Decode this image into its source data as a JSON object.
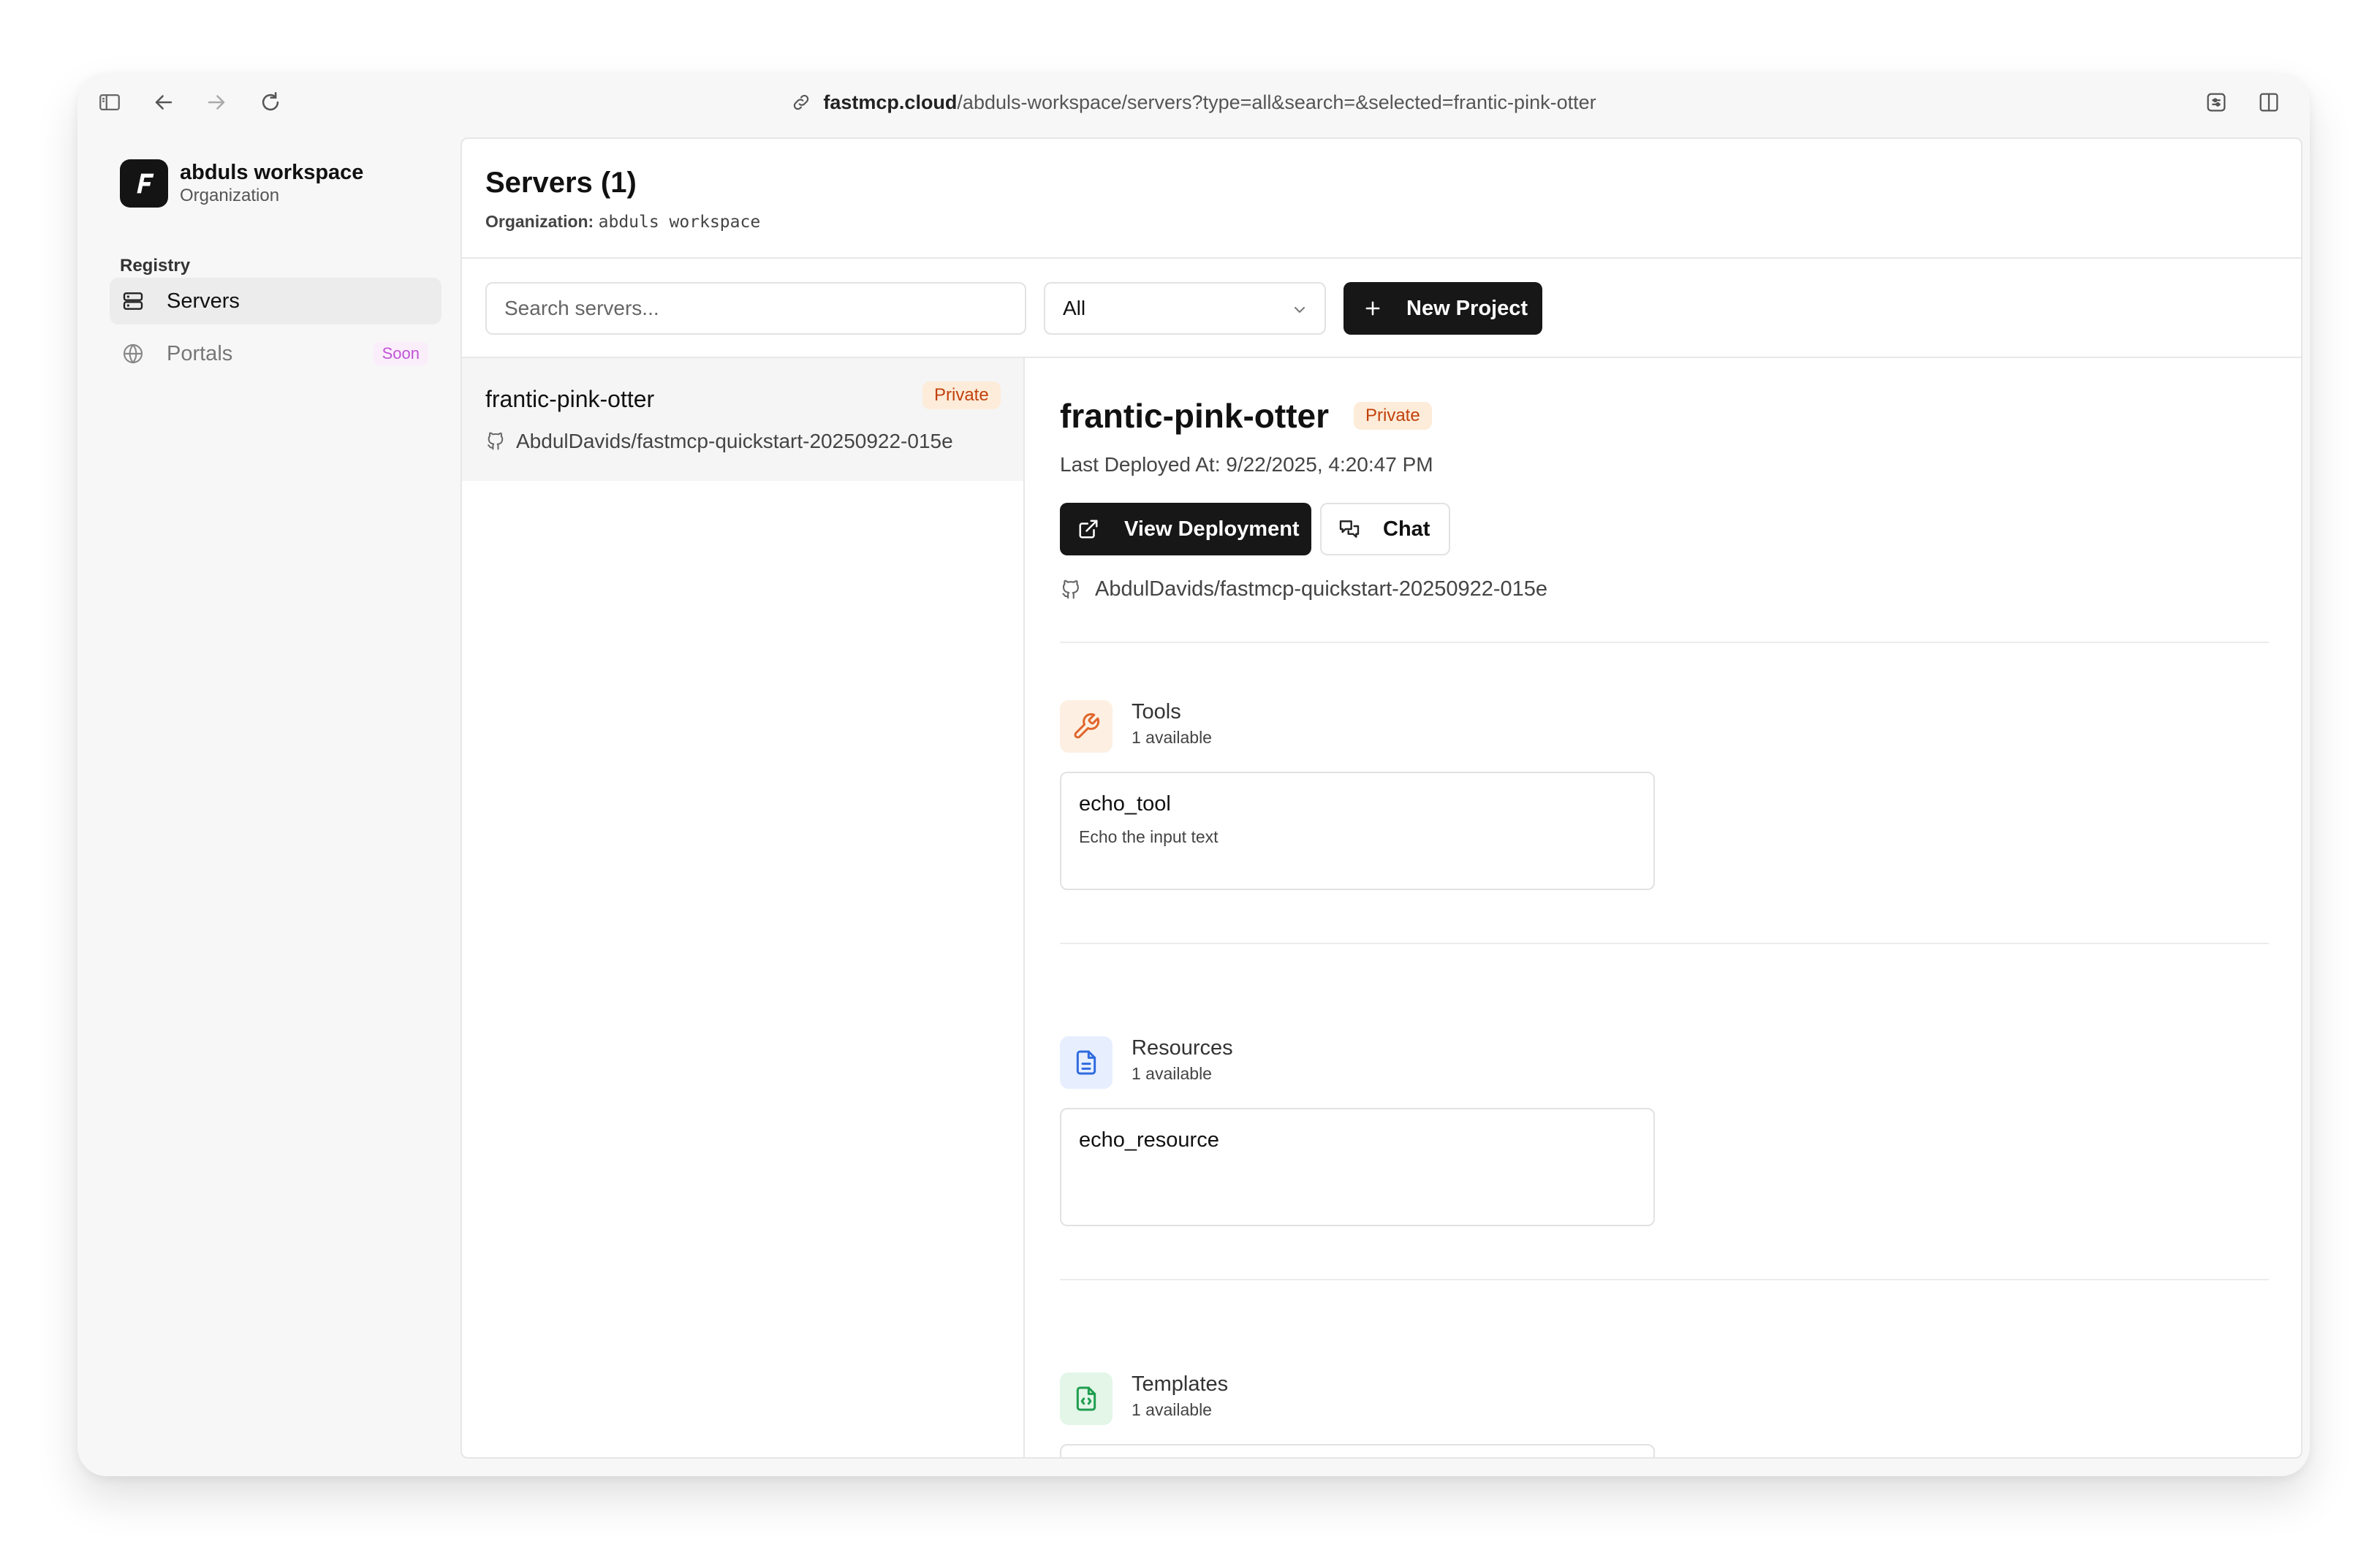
{
  "browser": {
    "url_host": "fastmcp.cloud",
    "url_path": "/abduls-workspace/servers?type=all&search=&selected=frantic-pink-otter"
  },
  "sidebar": {
    "workspace_name": "abduls workspace",
    "workspace_type": "Organization",
    "section_label": "Registry",
    "items": [
      {
        "label": "Servers",
        "icon": "server-icon",
        "active": true
      },
      {
        "label": "Portals",
        "icon": "globe-icon",
        "badge": "Soon"
      }
    ]
  },
  "header": {
    "title": "Servers (1)",
    "org_label": "Organization:",
    "org_value": "abduls workspace"
  },
  "filters": {
    "search_placeholder": "Search servers...",
    "type_selected": "All",
    "new_project_label": "New Project"
  },
  "server_list": [
    {
      "name": "frantic-pink-otter",
      "visibility": "Private",
      "repo": "AbdulDavids/fastmcp-quickstart-20250922-015e"
    }
  ],
  "detail": {
    "name": "frantic-pink-otter",
    "visibility": "Private",
    "last_deployed": "Last Deployed At: 9/22/2025, 4:20:47 PM",
    "view_deployment_label": "View Deployment",
    "chat_label": "Chat",
    "repo": "AbdulDavids/fastmcp-quickstart-20250922-015e",
    "sections": {
      "tools": {
        "title": "Tools",
        "count": "1 available",
        "items": [
          {
            "name": "echo_tool",
            "description": "Echo the input text"
          }
        ]
      },
      "resources": {
        "title": "Resources",
        "count": "1 available",
        "items": [
          {
            "name": "echo_resource"
          }
        ]
      },
      "templates": {
        "title": "Templates",
        "count": "1 available"
      }
    }
  },
  "colors": {
    "accent_dark": "#171717",
    "private_badge_text": "#c2410c",
    "private_badge_bg": "#fdecd9",
    "soon_badge_text": "#c054d6",
    "tools_icon_bg": "#fdf0e3",
    "resources_icon_bg": "#e7efff",
    "templates_icon_bg": "#e3f6e8"
  }
}
